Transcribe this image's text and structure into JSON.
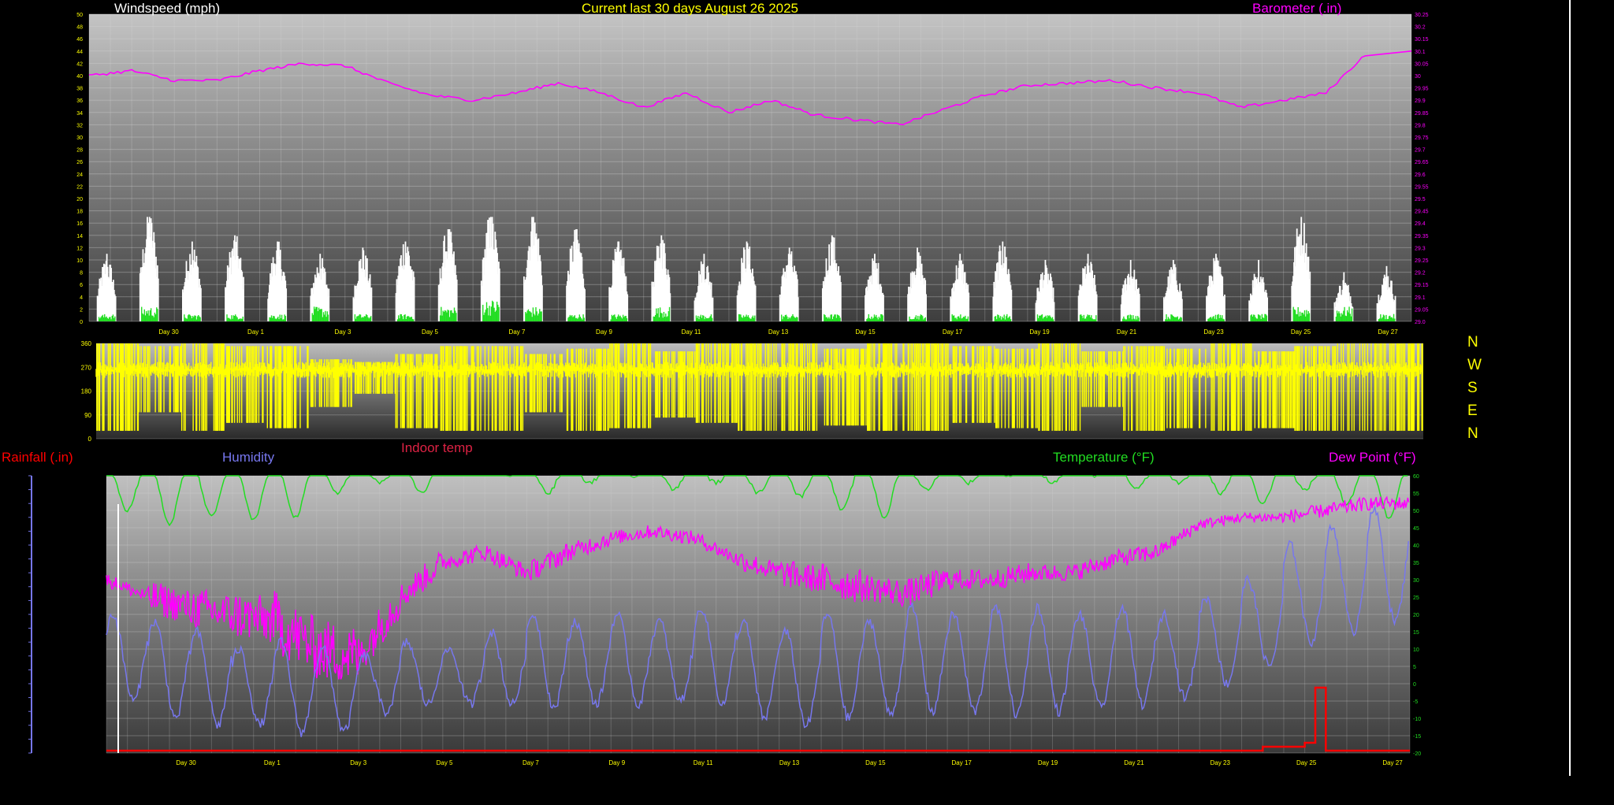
{
  "title": "Current last 30 days August 26 2025",
  "colors": {
    "windspeed": "#ffffff",
    "gust": "#22dd22",
    "barometer": "#ff00ff",
    "direction": "#ffff00",
    "rainfall": "#ff0000",
    "humidity": "#7777ee",
    "indoor_temp": "#dd2244",
    "temperature": "#22dd22",
    "dew_point": "#ff00ff",
    "title": "#ffff00",
    "axis_text": "#ffff00"
  },
  "x_axis_days": [
    "Day 30",
    "Day 1",
    "Day 3",
    "Day 5",
    "Day 7",
    "Day 9",
    "Day 11",
    "Day 13",
    "Day 15",
    "Day 17",
    "Day 19",
    "Day 21",
    "Day 23",
    "Day 25",
    "Day 27"
  ],
  "chart_data": [
    {
      "type": "area",
      "title": "Current last 30 days August 26 2025",
      "left_axis_label": "Windspeed (mph)",
      "right_axis_label": "Barometer (.in)",
      "left_ylim": [
        0,
        50
      ],
      "left_ticks": [
        "0",
        "2",
        "4",
        "6",
        "8",
        "10",
        "12",
        "14",
        "16",
        "18",
        "20",
        "22",
        "24",
        "26",
        "28",
        "30",
        "32",
        "34",
        "36",
        "38",
        "40",
        "42",
        "44",
        "46",
        "48",
        "50"
      ],
      "right_ylim": [
        29.0,
        30.25
      ],
      "right_ticks": [
        "29.0",
        "29.05",
        "29.1",
        "29.15",
        "29.2",
        "29.25",
        "29.3",
        "29.35",
        "29.4",
        "29.45",
        "29.5",
        "29.55",
        "29.6",
        "29.65",
        "29.7",
        "29.75",
        "29.8",
        "29.85",
        "29.9",
        "29.95",
        "30",
        "30.05",
        "30.1",
        "30.15",
        "30.2",
        "30.25"
      ],
      "x_labels": [
        "Day 30",
        "Day 1",
        "Day 3",
        "Day 5",
        "Day 7",
        "Day 9",
        "Day 11",
        "Day 13",
        "Day 15",
        "Day 17",
        "Day 19",
        "Day 21",
        "Day 23",
        "Day 25",
        "Day 27"
      ],
      "series": [
        {
          "name": "Windspeed (mph)",
          "type": "bar",
          "daily_peak_mph": [
            11,
            17,
            13,
            14,
            13,
            11,
            12,
            13,
            15,
            17,
            17,
            15,
            13,
            14,
            11,
            13,
            12,
            14,
            11,
            12,
            11,
            13,
            10,
            11,
            10,
            10,
            11,
            10,
            17,
            8,
            9
          ],
          "values": [
            9,
            15,
            11,
            12,
            11,
            9,
            10,
            12,
            13,
            15,
            15,
            13,
            11,
            12,
            9,
            11,
            10,
            12,
            9,
            10,
            9,
            11,
            8,
            9,
            8,
            8,
            9,
            8,
            15,
            6,
            7
          ]
        },
        {
          "name": "Gust (mph)",
          "type": "bar",
          "values": [
            1,
            2,
            1,
            1,
            1,
            2,
            1,
            1,
            2,
            3,
            2,
            1,
            1,
            2,
            1,
            1,
            1,
            1,
            1,
            1,
            1,
            1,
            1,
            1,
            1,
            1,
            1,
            1,
            2,
            2,
            1
          ]
        },
        {
          "name": "Barometer (.in)",
          "type": "line",
          "values": [
            30.0,
            30.02,
            29.98,
            29.98,
            30.02,
            30.05,
            30.04,
            29.97,
            29.92,
            29.9,
            29.93,
            29.97,
            29.93,
            29.87,
            29.93,
            29.85,
            29.9,
            29.84,
            29.82,
            29.8,
            29.86,
            29.92,
            29.96,
            29.97,
            29.98,
            29.95,
            29.93,
            29.87,
            29.9,
            29.93,
            30.1
          ]
        }
      ]
    },
    {
      "type": "line",
      "series_name": "Wind direction",
      "ylim": [
        0,
        360
      ],
      "y_ticks": [
        "0",
        "90",
        "180",
        "270",
        "360"
      ],
      "compass_labels": [
        "N",
        "W",
        "S",
        "E",
        "N"
      ],
      "x_labels": [
        "Day 30",
        "Day 1",
        "Day 3",
        "Day 5",
        "Day 7",
        "Day 9",
        "Day 11",
        "Day 13",
        "Day 15",
        "Day 17",
        "Day 19",
        "Day 21",
        "Day 23",
        "Day 25",
        "Day 27"
      ],
      "typical_deg": 260,
      "day_ranges_deg": [
        [
          30,
          360
        ],
        [
          100,
          350
        ],
        [
          30,
          360
        ],
        [
          60,
          350
        ],
        [
          40,
          350
        ],
        [
          120,
          300
        ],
        [
          170,
          290
        ],
        [
          40,
          320
        ],
        [
          30,
          350
        ],
        [
          30,
          350
        ],
        [
          100,
          320
        ],
        [
          30,
          340
        ],
        [
          40,
          360
        ],
        [
          80,
          330
        ],
        [
          60,
          360
        ],
        [
          30,
          360
        ],
        [
          30,
          360
        ],
        [
          50,
          340
        ],
        [
          30,
          360
        ],
        [
          30,
          360
        ],
        [
          60,
          350
        ],
        [
          40,
          340
        ],
        [
          30,
          360
        ],
        [
          120,
          330
        ],
        [
          30,
          350
        ],
        [
          40,
          340
        ],
        [
          30,
          360
        ],
        [
          40,
          330
        ],
        [
          30,
          350
        ],
        [
          30,
          360
        ],
        [
          30,
          360
        ]
      ]
    },
    {
      "type": "line",
      "left_axis_label": "Rainfall (.in)",
      "right_axis_label": "Temperature (°F)",
      "series_labels": [
        "Humidity",
        "Indoor temp",
        "Temperature (°F)",
        "Dew Point (°F)"
      ],
      "right_ylim": [
        -20,
        60
      ],
      "right_ticks": [
        "-20",
        "-15",
        "-10",
        "-5",
        "0",
        "5",
        "10",
        "15",
        "20",
        "25",
        "30",
        "35",
        "40",
        "45",
        "50",
        "55",
        "60"
      ],
      "x_labels": [
        "Day 30",
        "Day 1",
        "Day 3",
        "Day 5",
        "Day 7",
        "Day 9",
        "Day 11",
        "Day 13",
        "Day 15",
        "Day 17",
        "Day 19",
        "Day 21",
        "Day 23",
        "Day 25",
        "Day 27"
      ],
      "series": [
        {
          "name": "Temperature (°F)",
          "daily_min": [
            50,
            46,
            48,
            47,
            48,
            55,
            58,
            55,
            60,
            60,
            55,
            58,
            60,
            56,
            58,
            55,
            54,
            50,
            48,
            56,
            58,
            60,
            58,
            60,
            56,
            58,
            55,
            52,
            56,
            52,
            48
          ],
          "daily_max": [
            62,
            62,
            62,
            62,
            62,
            62,
            62,
            62,
            62,
            62,
            62,
            62,
            62,
            62,
            62,
            62,
            62,
            62,
            62,
            62,
            62,
            62,
            62,
            62,
            62,
            62,
            62,
            62,
            62,
            62,
            62
          ]
        },
        {
          "name": "Dew Point (°F)",
          "daily_mean": [
            30,
            25,
            22,
            20,
            18,
            10,
            8,
            25,
            35,
            38,
            32,
            38,
            42,
            44,
            42,
            36,
            32,
            30,
            28,
            26,
            30,
            30,
            32,
            32,
            36,
            38,
            46,
            48,
            48,
            50,
            52
          ],
          "daily_spread": [
            4,
            10,
            12,
            14,
            18,
            18,
            12,
            8,
            5,
            5,
            6,
            5,
            4,
            4,
            4,
            6,
            8,
            10,
            8,
            8,
            6,
            6,
            5,
            5,
            5,
            4,
            3,
            3,
            4,
            4,
            4
          ]
        },
        {
          "name": "Humidity",
          "daily_low": [
            -5,
            -10,
            -12,
            -12,
            -14,
            -14,
            -8,
            -6,
            -6,
            -6,
            -7,
            -6,
            -6,
            -5,
            -6,
            -10,
            -12,
            -10,
            -9,
            -8,
            -8,
            -9,
            -8,
            -7,
            -6,
            -4,
            0,
            5,
            12,
            15,
            18
          ],
          "daily_high": [
            20,
            18,
            15,
            10,
            12,
            10,
            8,
            12,
            10,
            15,
            20,
            18,
            20,
            18,
            22,
            18,
            15,
            20,
            18,
            22,
            20,
            22,
            22,
            20,
            22,
            20,
            25,
            30,
            40,
            45,
            50
          ]
        },
        {
          "name": "Rainfall (.in)",
          "steps_days": [
            27.8,
            28.5,
            29.5,
            29.75,
            30.0
          ],
          "steps_levels": [
            0,
            0.05,
            0.1,
            0.8,
            0
          ]
        }
      ]
    }
  ],
  "labels": {
    "windspeed": "Windspeed (mph)",
    "barometer": "Barometer (.in)",
    "rainfall": "Rainfall (.in)",
    "humidity": "Humidity",
    "indoor_temp": "Indoor temp",
    "temperature": "Temperature (°F)",
    "dew_point": "Dew Point (°F)",
    "compass": [
      "N",
      "W",
      "S",
      "E",
      "N"
    ]
  }
}
